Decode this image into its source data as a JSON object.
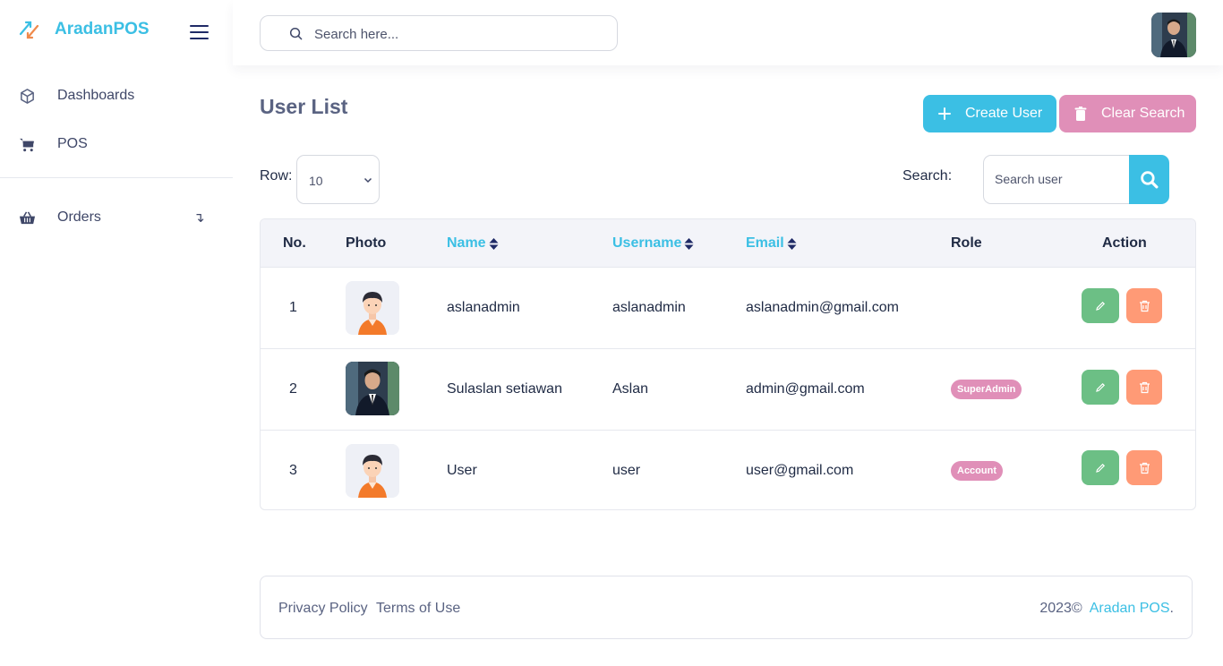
{
  "brand": {
    "name": "AradanPOS"
  },
  "sidebar": {
    "items": [
      {
        "label": "Dashboards",
        "icon": "cube-icon"
      },
      {
        "label": "POS",
        "icon": "cart-icon"
      },
      {
        "label": "Orders",
        "icon": "basket-icon"
      }
    ]
  },
  "topbar": {
    "search_placeholder": "Search here..."
  },
  "page": {
    "title": "User List",
    "create_button": "Create User",
    "clear_button": "Clear Search",
    "row_label": "Row:",
    "row_value": "10",
    "search_label": "Search:",
    "search_placeholder": "Search user"
  },
  "table": {
    "headers": {
      "no": "No.",
      "photo": "Photo",
      "name": "Name",
      "username": "Username",
      "email": "Email",
      "role": "Role",
      "action": "Action"
    },
    "rows": [
      {
        "no": "1",
        "photo": "cartoon",
        "name": "aslanadmin",
        "username": "aslanadmin",
        "email": "aslanadmin@gmail.com",
        "role": ""
      },
      {
        "no": "2",
        "photo": "real",
        "name": "Sulaslan setiawan",
        "username": "Aslan",
        "email": "admin@gmail.com",
        "role": "SuperAdmin"
      },
      {
        "no": "3",
        "photo": "cartoon",
        "name": "User",
        "username": "user",
        "email": "user@gmail.com",
        "role": "Account"
      }
    ]
  },
  "footer": {
    "privacy": "Privacy Policy",
    "terms": "Terms of Use",
    "copyright": "2023©",
    "brand_link": "Aradan POS",
    "period": "."
  },
  "colors": {
    "accent": "#3bbfe4",
    "pink": "#e08fb8",
    "edit": "#6cbf85",
    "delete": "#ff9a76"
  }
}
